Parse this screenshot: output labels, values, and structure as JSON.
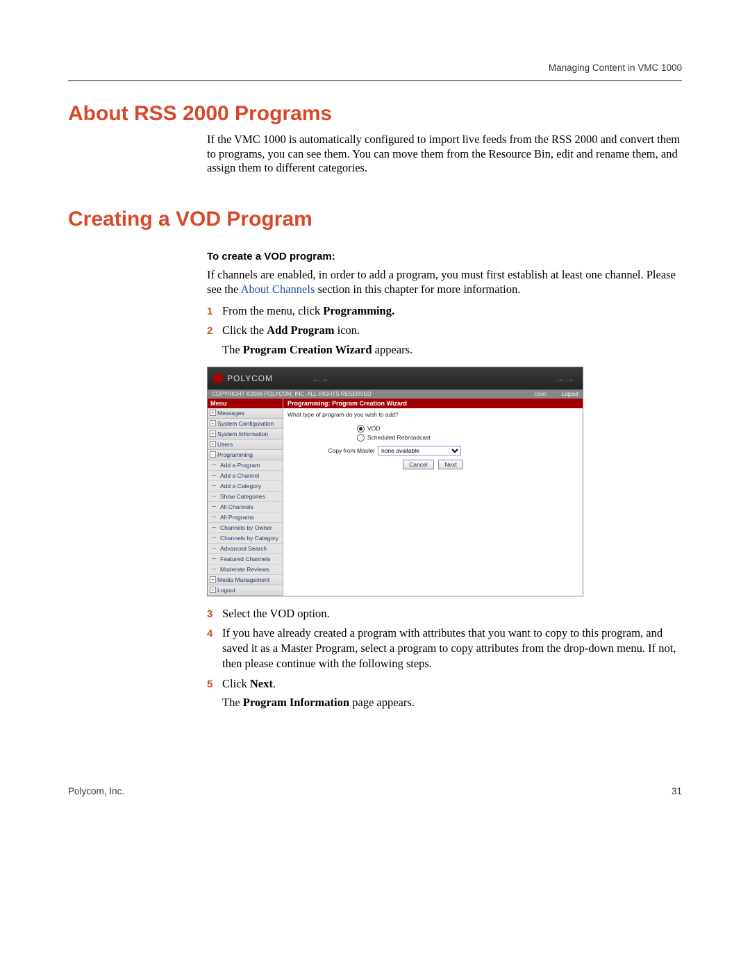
{
  "header": {
    "right": "Managing Content in VMC 1000"
  },
  "section1": {
    "title": "About RSS 2000 Programs",
    "body": "If the VMC 1000 is automatically configured to import live feeds from the RSS 2000 and convert them to programs, you can see them. You can move them from the Resource Bin, edit and rename them, and assign them to different categories."
  },
  "section2": {
    "title": "Creating a VOD Program",
    "subhead": "To create a VOD program:",
    "intro_before": "If channels are enabled, in order to add a program, you must first establish at least one channel. Please see the ",
    "intro_link": "About Channels",
    "intro_after": " section in this chapter for more information.",
    "steps_a": [
      {
        "n": "1",
        "pre": "From the menu, click ",
        "bold": "Programming.",
        "post": ""
      },
      {
        "n": "2",
        "pre": "Click the ",
        "bold": "Add Program",
        "post": " icon."
      }
    ],
    "note_a_pre": "The ",
    "note_a_bold": "Program Creation Wizard",
    "note_a_post": " appears.",
    "steps_b": [
      {
        "n": "3",
        "text": "Select the VOD option."
      },
      {
        "n": "4",
        "text": "If you have already created a program with attributes that you want to copy to this program, and saved it as a Master Program, select a program to copy attributes from the drop-down menu. If not, then please continue with the following steps."
      },
      {
        "n": "5",
        "pre": "Click ",
        "bold": "Next",
        "post": "."
      }
    ],
    "note_b_pre": "The ",
    "note_b_bold": "Program Information",
    "note_b_post": " page appears."
  },
  "appshot": {
    "brand": "POLYCOM",
    "copybar_left": "COPYRIGHT ©2008 POLYCOM, INC. ALL RIGHTS RESERVED",
    "copybar_user_label": "User:",
    "copybar_logout": "Logout",
    "menu_head": "Menu",
    "menu": {
      "top": [
        "Messages",
        "System Configuration",
        "System Information",
        "Users"
      ],
      "programming": "Programming",
      "subs": [
        "Add a Program",
        "Add a Channel",
        "Add a Category",
        "Show Categories",
        "All Channels",
        "All Programs",
        "Channels by Owner",
        "Channels by Category",
        "Advanced Search",
        "Featured Channels",
        "Moderate Reviews"
      ],
      "bottom": [
        "Media Management",
        "Logout"
      ]
    },
    "main_head": "Programming: Program Creation Wizard",
    "question": "What type of program do you wish to add?",
    "opt_vod": "VOD",
    "opt_sched": "Scheduled Rebroadcast",
    "copy_label": "Copy from Master",
    "copy_value": "none available",
    "btn_cancel": "Cancel",
    "btn_next": "Next"
  },
  "footer": {
    "left": "Polycom, Inc.",
    "right": "31"
  }
}
